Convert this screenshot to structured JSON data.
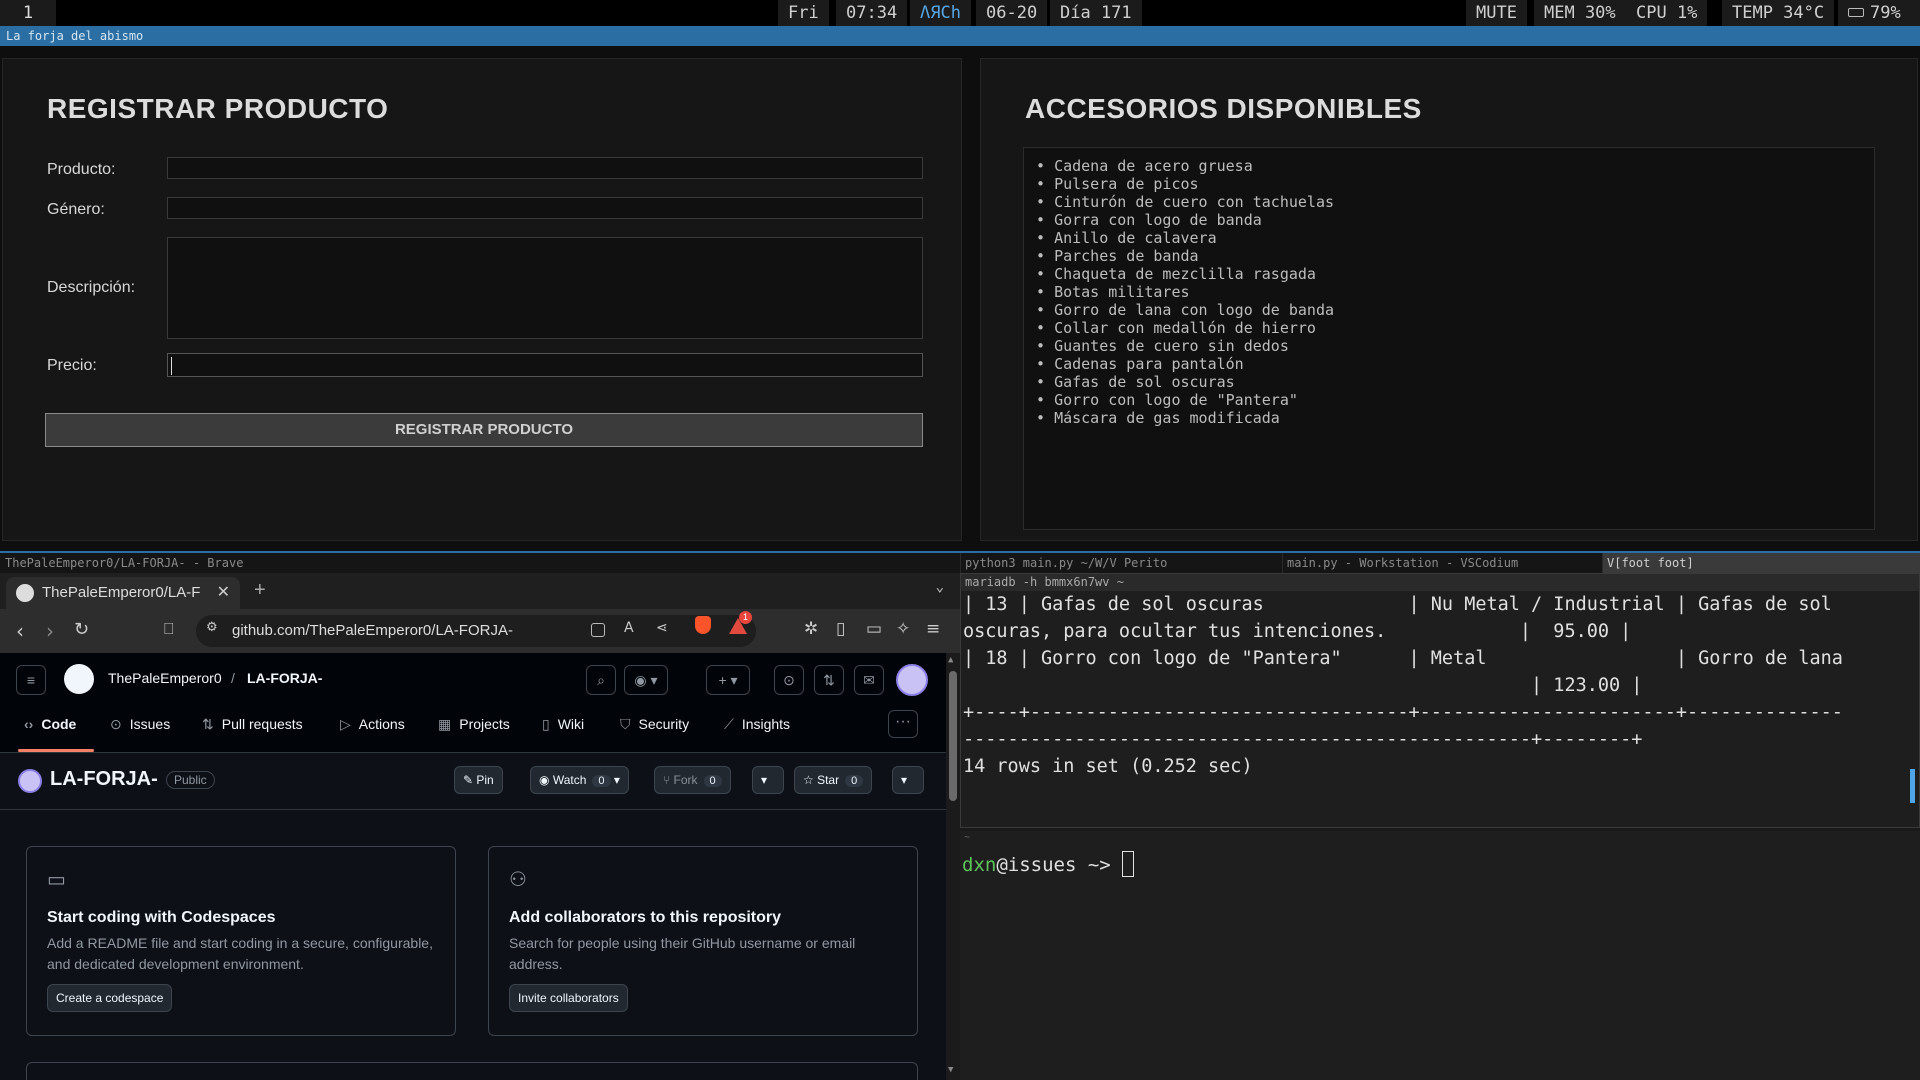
{
  "topbar": {
    "workspace": "1",
    "day": "Fri",
    "time": "07:34",
    "distro": "ΛЯCh",
    "date": "06-20",
    "day_of_year": "Día 171",
    "audio": "MUTE",
    "mem": "MEM 30%",
    "cpu": "CPU  1%",
    "temp": "TEMP 34°C",
    "battery": "79%"
  },
  "window_title": "La forja del abismo",
  "registrar": {
    "heading": "REGISTRAR PRODUCTO",
    "fields": {
      "producto": {
        "label": "Producto:",
        "value": ""
      },
      "genero": {
        "label": "Género:",
        "value": ""
      },
      "descripcion": {
        "label": "Descripción:",
        "value": ""
      },
      "precio": {
        "label": "Precio:",
        "value": ""
      }
    },
    "submit_label": "REGISTRAR PRODUCTO"
  },
  "accesorios": {
    "heading": "ACCESORIOS DISPONIBLES",
    "items": [
      "Cadena de acero gruesa",
      "Pulsera de picos",
      "Cinturón de cuero con tachuelas",
      "Gorra con logo de banda",
      "Anillo de calavera",
      "Parches de banda",
      "Chaqueta de mezclilla rasgada",
      "Botas militares",
      "Gorro de lana con logo de banda",
      "Collar con medallón de hierro",
      "Guantes de cuero sin dedos",
      "Cadenas para pantalón",
      "Gafas de sol oscuras",
      "Gorro con logo de \"Pantera\"",
      "Máscara de gas modificada"
    ]
  },
  "browser": {
    "window_title": "ThePaleEmperor0/LA-FORJA- - Brave",
    "tab_title": "ThePaleEmperor0/LA-F",
    "url": "github.com/ThePaleEmperor0/LA-FORJA-",
    "rewards_badge": "1",
    "github": {
      "owner": "ThePaleEmperor0",
      "slash": "/",
      "repo": "LA-FORJA-",
      "nav": [
        "Code",
        "Issues",
        "Pull requests",
        "Actions",
        "Projects",
        "Wiki",
        "Security",
        "Insights"
      ],
      "repo_title": "LA-FORJA-",
      "visibility": "Public",
      "pin_label": "Pin",
      "watch_label": "Watch",
      "watch_count": "0",
      "fork_label": "Fork",
      "fork_count": "0",
      "star_label": "Star",
      "star_count": "0",
      "cards": [
        {
          "title": "Start coding with Codespaces",
          "text": "Add a README file and start coding in a secure, configurable, and dedicated development environment.",
          "button": "Create a codespace"
        },
        {
          "title": "Add collaborators to this repository",
          "text": "Search for people using their GitHub username or email address.",
          "button": "Invite collaborators"
        }
      ]
    }
  },
  "terminals": {
    "tabs": [
      "python3 main.py ~/W/V Perito",
      "main.py - Workstation - VSCodium",
      "V[foot foot]"
    ],
    "mariadb_title": "mariadb -h bmmx6n7wv ~",
    "output_lines": [
      "| 13 | Gafas de sol oscuras             | Nu Metal / Industrial | Gafas de sol",
      "oscuras, para ocultar tus intenciones.            |  95.00 |",
      "| 18 | Gorro con logo de \"Pantera\"      | Metal                 | Gorro de lana",
      "                                                   | 123.00 |",
      "+----+----------------------------------+-----------------------+--------------",
      "---------------------------------------------------+--------+",
      "14 rows in set (0.252 sec)"
    ],
    "shell_title": "~",
    "prompt_user": "dxn",
    "prompt_host": "@issues",
    "prompt_dir": " ~> "
  }
}
